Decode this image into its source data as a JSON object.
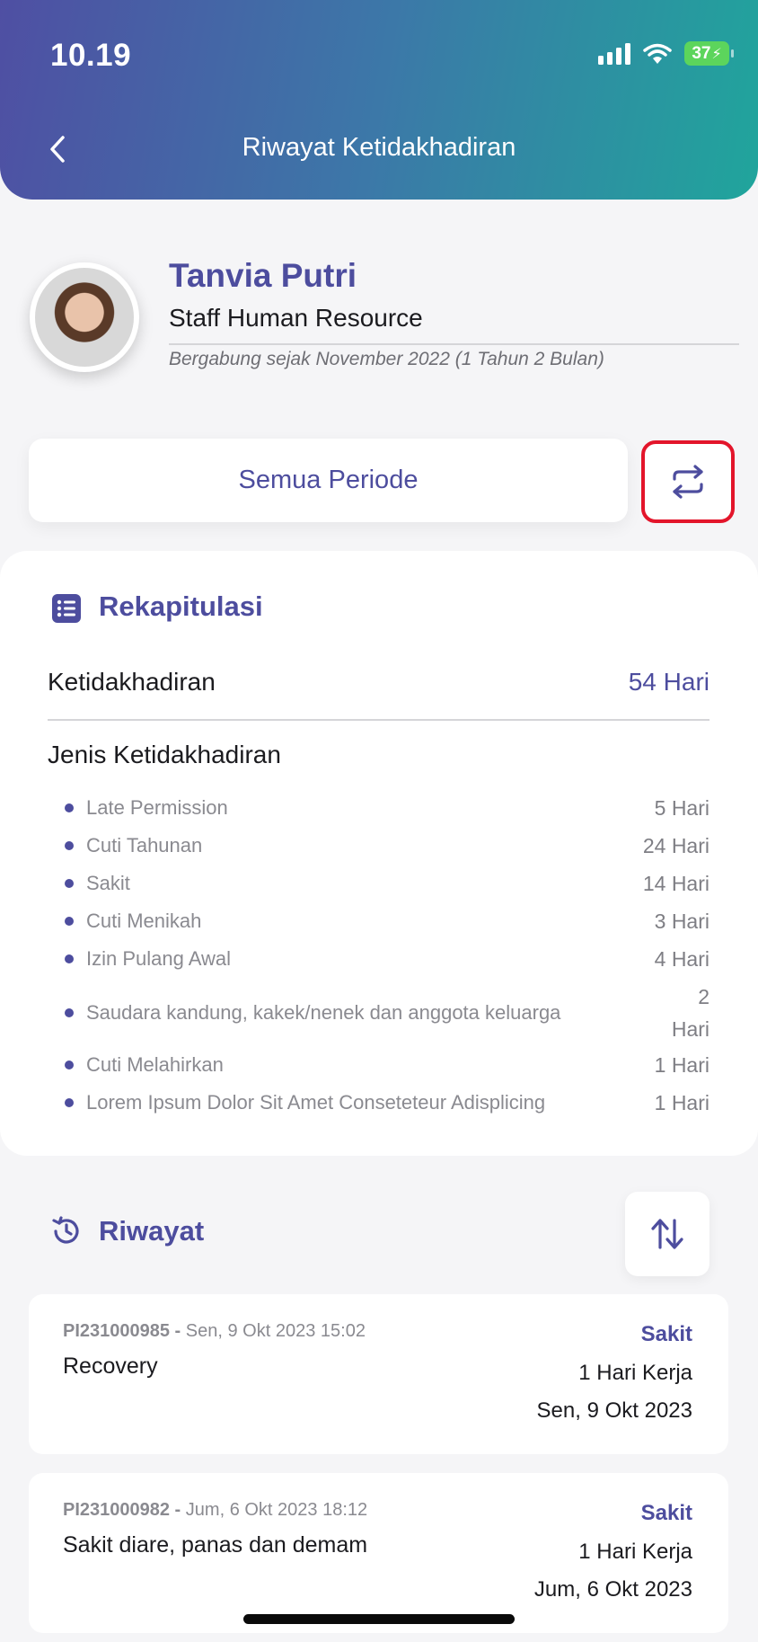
{
  "status_bar": {
    "time": "10.19",
    "battery": "37"
  },
  "header": {
    "title": "Riwayat Ketidakhadiran"
  },
  "profile": {
    "name": "Tanvia Putri",
    "role": "Staff Human Resource",
    "joined": "Bergabung sejak November 2022 (1 Tahun 2 Bulan)"
  },
  "filter": {
    "period_label": "Semua Periode"
  },
  "recap": {
    "title": "Rekapitulasi",
    "absence_label": "Ketidakhadiran",
    "absence_value": "54 Hari",
    "types_title": "Jenis Ketidakhadiran",
    "types": [
      {
        "name": "Late Permission",
        "value": "5 Hari"
      },
      {
        "name": "Cuti Tahunan",
        "value": "24 Hari"
      },
      {
        "name": "Sakit",
        "value": "14 Hari"
      },
      {
        "name": "Cuti Menikah",
        "value": "3 Hari"
      },
      {
        "name": "Izin Pulang Awal",
        "value": "4 Hari"
      },
      {
        "name": "Saudara kandung, kakek/nenek dan anggota keluarga",
        "value": "2 Hari"
      },
      {
        "name": "Cuti Melahirkan",
        "value": "1 Hari"
      },
      {
        "name": "Lorem Ipsum Dolor Sit Amet Conseteteur Adisplicing",
        "value": "1 Hari"
      }
    ]
  },
  "history": {
    "title": "Riwayat",
    "items": [
      {
        "id": "PI231000985 -",
        "timestamp": "Sen, 9 Okt 2023 15:02",
        "description": "Recovery",
        "type": "Sakit",
        "duration": "1 Hari Kerja",
        "date": "Sen, 9 Okt 2023"
      },
      {
        "id": "PI231000982 -",
        "timestamp": "Jum, 6 Okt 2023 18:12",
        "description": "Sakit diare, panas dan demam",
        "type": "Sakit",
        "duration": "1 Hari Kerja",
        "date": "Jum, 6 Okt 2023"
      }
    ]
  },
  "colors": {
    "accent": "#4d4d9e",
    "highlight_border": "#e3152b",
    "gradient_start": "#4f4fa3",
    "gradient_end": "#20a59c"
  }
}
